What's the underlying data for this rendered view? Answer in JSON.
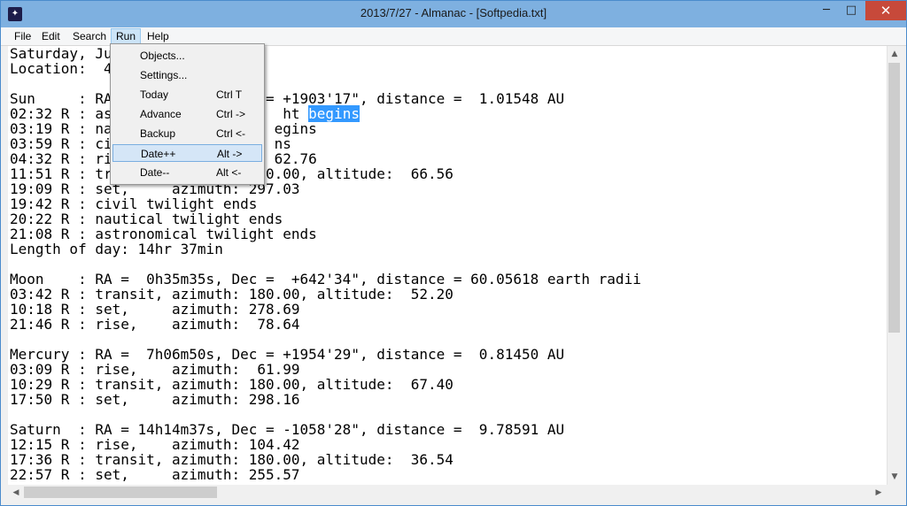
{
  "window": {
    "title": "2013/7/27 - Almanac - [Softpedia.txt]"
  },
  "title_buttons": {
    "minimize": "─",
    "maximize": "□",
    "close": "✕"
  },
  "menubar": {
    "file": "File",
    "edit": "Edit",
    "search": "Search",
    "run": "Run",
    "help": "Help"
  },
  "run_menu": {
    "items": [
      {
        "label": "Objects...",
        "shortcut": ""
      },
      {
        "label": "Settings...",
        "shortcut": ""
      },
      {
        "label": "Today",
        "shortcut": "Ctrl T"
      },
      {
        "label": "Advance",
        "shortcut": "Ctrl ->"
      },
      {
        "label": "Backup",
        "shortcut": "Ctrl <-"
      },
      {
        "label": "Date++",
        "shortcut": "Alt ->"
      },
      {
        "label": "Date--",
        "shortcut": "Alt <-"
      }
    ],
    "highlighted": "Date++"
  },
  "editor": {
    "selected_text": "begins",
    "lines": [
      "Saturday, Ju",
      "Location:  4",
      "",
      "Sun     : RA                  = +1903'17\", distance =  1.01548 AU",
      "02:32 R : as                    ht ",
      "03:19 R : na                   egins",
      "03:59 R : ci                   ns",
      "04:32 R : ri                   62.76",
      "11:51 R : tr                 80.00, altitude:  66.56",
      "19:09 R : set,     azimuth: 297.03",
      "19:42 R : civil twilight ends",
      "20:22 R : nautical twilight ends",
      "21:08 R : astronomical twilight ends",
      "Length of day: 14hr 37min",
      "",
      "Moon    : RA =  0h35m35s, Dec =  +642'34\", distance = 60.05618 earth radii",
      "03:42 R : transit, azimuth: 180.00, altitude:  52.20",
      "10:18 R : set,     azimuth: 278.69",
      "21:46 R : rise,    azimuth:  78.64",
      "",
      "Mercury : RA =  7h06m50s, Dec = +1954'29\", distance =  0.81450 AU",
      "03:09 R : rise,    azimuth:  61.99",
      "10:29 R : transit, azimuth: 180.00, altitude:  67.40",
      "17:50 R : set,     azimuth: 298.16",
      "",
      "Saturn  : RA = 14h14m37s, Dec = -1058'28\", distance =  9.78591 AU",
      "12:15 R : rise,    azimuth: 104.42",
      "17:36 R : transit, azimuth: 180.00, altitude:  36.54",
      "22:57 R : set,     azimuth: 255.57"
    ]
  },
  "icons": {
    "app": "almanac-app-icon",
    "scroll_up": "arrow-up-icon",
    "scroll_down": "arrow-down-icon",
    "scroll_left": "arrow-left-icon",
    "scroll_right": "arrow-right-icon"
  },
  "colors": {
    "titlebar": "#7eb0e0",
    "close": "#c7493a",
    "selection": "#3399ff",
    "menu_highlight": "#d5e6f7"
  }
}
